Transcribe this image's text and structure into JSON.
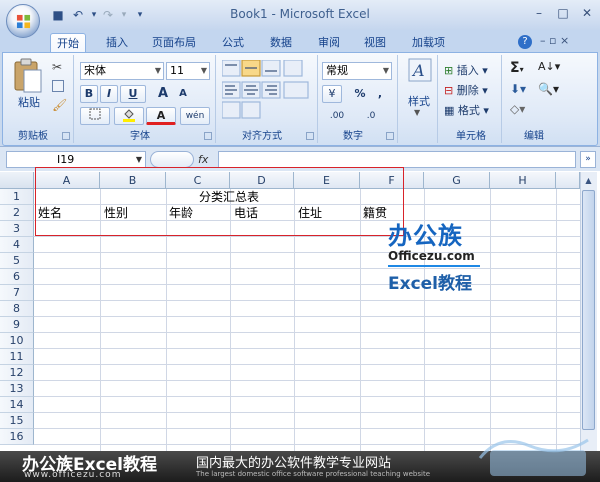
{
  "window": {
    "title": "Book1 - Microsoft Excel"
  },
  "quick_access": {
    "save": "■",
    "undo": "↶",
    "redo": "↷",
    "customize": "▾"
  },
  "window_buttons": {
    "minimize": "–",
    "restore": "□",
    "close": "✕"
  },
  "tabs": [
    {
      "label": "开始",
      "active": true
    },
    {
      "label": "插入"
    },
    {
      "label": "页面布局"
    },
    {
      "label": "公式"
    },
    {
      "label": "数据"
    },
    {
      "label": "审阅"
    },
    {
      "label": "视图"
    },
    {
      "label": "加载项"
    }
  ],
  "ribbon": {
    "clipboard": {
      "label": "剪贴板",
      "paste": "粘贴"
    },
    "font": {
      "label": "字体",
      "name": "宋体",
      "size": "11",
      "bold": "B",
      "italic": "I",
      "underline": "U",
      "grow": "A",
      "shrink": "A",
      "phonetic": "wén"
    },
    "alignment": {
      "label": "对齐方式"
    },
    "number": {
      "label": "数字",
      "format": "常规",
      "currency": "¥",
      "percent": "%",
      "comma": ",",
      "inc_decimal": ".00",
      "dec_decimal": ".0"
    },
    "styles": {
      "label": "样式"
    },
    "cells": {
      "label": "单元格",
      "insert": "插入",
      "delete": "删除",
      "format": "格式"
    },
    "editing": {
      "label": "编辑",
      "sigma": "Σ"
    }
  },
  "formula_bar": {
    "name_box": "I19",
    "fx": "fx",
    "value": ""
  },
  "columns": [
    "A",
    "B",
    "C",
    "D",
    "E",
    "F",
    "G",
    "H"
  ],
  "rows": [
    "1",
    "2",
    "3",
    "4",
    "5",
    "6",
    "7",
    "8",
    "9",
    "10",
    "11",
    "12",
    "13",
    "14",
    "15",
    "16"
  ],
  "cells": {
    "title": "分类汇总表",
    "headers": [
      "姓名",
      "性别",
      "年龄",
      "电话",
      "住址",
      "籍贯"
    ]
  },
  "watermark": {
    "brand": "办公族",
    "site": "Officezu.com",
    "tag": "Excel教程"
  },
  "footer": {
    "brand": "办公族Excel教程",
    "url": "www.officezu.com",
    "slogan": "国内最大的办公软件教学专业网站",
    "sub": "The largest domestic office software professional teaching website"
  }
}
